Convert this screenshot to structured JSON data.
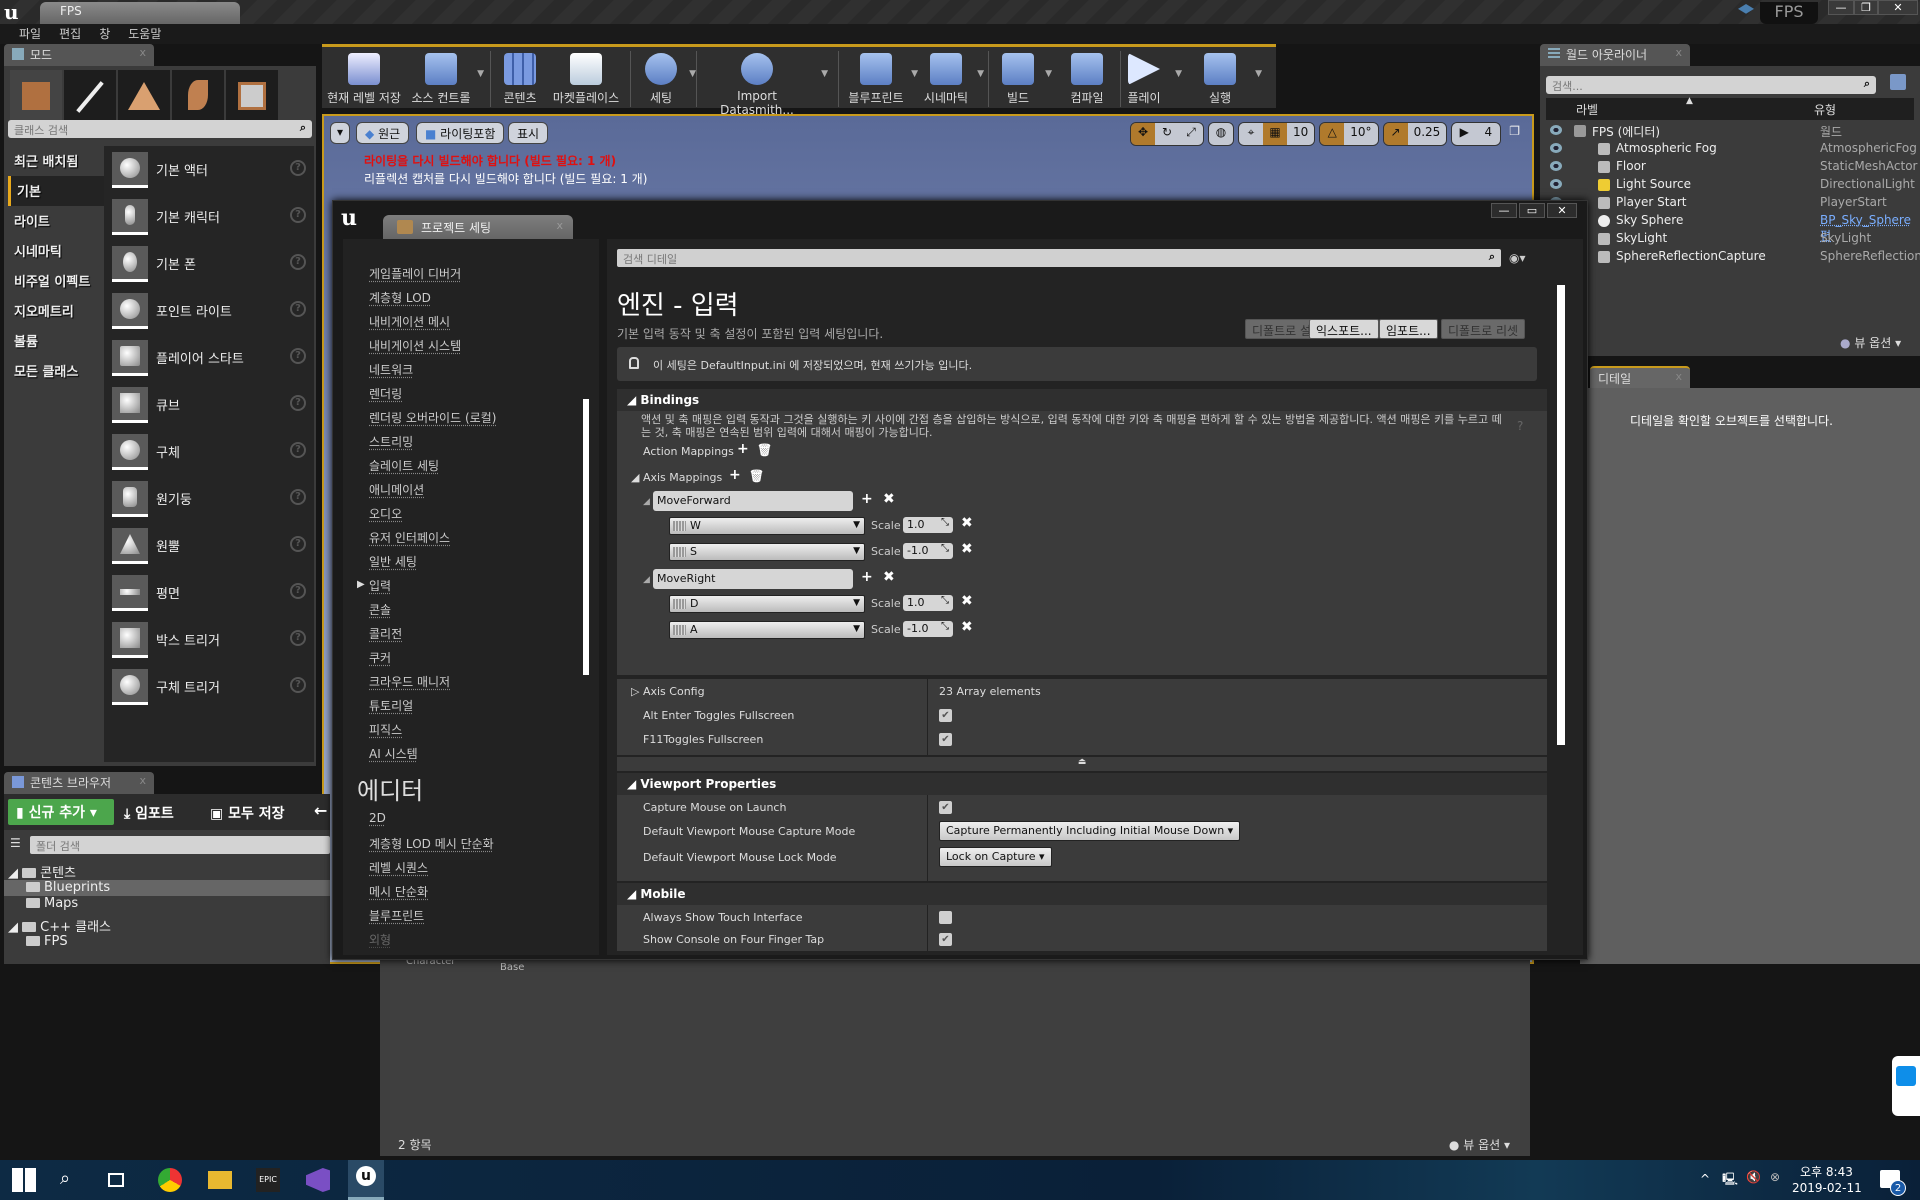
{
  "window": {
    "doc_tab": "FPS",
    "app_name": "FPS",
    "minimize": "—",
    "restore": "❐",
    "close": "✕"
  },
  "menu": [
    "파일",
    "편집",
    "창",
    "도움말"
  ],
  "modes": {
    "tab_label": "모드",
    "search_placeholder": "클래스 검색",
    "categories": [
      "최근 배치됨",
      "기본",
      "라이트",
      "시네마틱",
      "비주얼 이펙트",
      "지오메트리",
      "볼륨",
      "모든 클래스"
    ],
    "active_category": "기본",
    "items": [
      "기본 액터",
      "기본 캐릭터",
      "기본 폰",
      "포인트 라이트",
      "플레이어 스타트",
      "큐브",
      "구체",
      "원기둥",
      "원뿔",
      "평면",
      "박스 트리거",
      "구체 트리거"
    ]
  },
  "toolbar": {
    "buttons": [
      "현재 레벨 저장",
      "소스 컨트롤",
      "콘텐츠",
      "마켓플레이스",
      "세팅",
      "Import Datasmith...",
      "블루프린트",
      "시네마틱",
      "빌드",
      "컴파일",
      "플레이",
      "실행"
    ]
  },
  "viewport": {
    "perspective": "원근",
    "lit": "라이팅포함",
    "show": "표시",
    "lighting_warning": "라이팅을 다시 빌드해야 합니다 (빌드 필요: 1 개)",
    "reflection_warning": "리플렉션 캡처를 다시 빌드해야 합니다 (빌드 필요: 1 개)",
    "grid_snap": "10",
    "rotation_snap": "10°",
    "scale_snap": "0.25",
    "camera_speed": "4"
  },
  "outliner": {
    "tab_label": "월드 아웃라이너",
    "search_placeholder": "검색...",
    "col_label": "라벨",
    "col_type": "유형",
    "rows": [
      {
        "name": "FPS (에디터)",
        "type": "월드"
      },
      {
        "name": "Atmospheric Fog",
        "type": "AtmosphericFog"
      },
      {
        "name": "Floor",
        "type": "StaticMeshActor"
      },
      {
        "name": "Light Source",
        "type": "DirectionalLight"
      },
      {
        "name": "Player Start",
        "type": "PlayerStart"
      },
      {
        "name": "Sky Sphere",
        "type": "BP_Sky_Sphere 편"
      },
      {
        "name": "SkyLight",
        "type": "SkyLight"
      },
      {
        "name": "SphereReflectionCapture",
        "type": "SphereReflectionC"
      }
    ],
    "view_options": "뷰 옵션"
  },
  "details": {
    "tab_label": "디테일",
    "message": "디테일을 확인할 오브젝트를 선택합니다."
  },
  "content_browser": {
    "tab_label": "콘텐츠 브라우저",
    "add_new": "신규 추가",
    "import": "임포트",
    "save_all": "모두 저장",
    "folder_search_placeholder": "폴더 검색",
    "tree": [
      {
        "label": "콘텐츠",
        "level": 0
      },
      {
        "label": "Blueprints",
        "level": 1,
        "selected": true
      },
      {
        "label": "Maps",
        "level": 1
      },
      {
        "label": "C++ 클래스",
        "level": 0
      },
      {
        "label": "FPS",
        "level": 1
      }
    ],
    "assets": [
      "Character",
      "Base"
    ],
    "item_count": "2 항목",
    "view_options": "뷰 옵션"
  },
  "project_settings": {
    "tab_label": "프로젝트 세팅",
    "nav_engine": [
      "게임플레이 디버거",
      "계층형 LOD",
      "내비게이션 메시",
      "내비게이션 시스템",
      "네트워크",
      "렌더링",
      "렌더링 오버라이드 (로컬)",
      "스트리밍",
      "슬레이트 세팅",
      "애니메이션",
      "오디오",
      "유저 인터페이스",
      "일반 세팅",
      "입력",
      "콘솔",
      "콜리전",
      "쿠커",
      "크라우드 매니저",
      "튜토리얼",
      "피직스",
      "AI 시스템"
    ],
    "nav_editor_heading": "에디터",
    "nav_editor": [
      "2D",
      "계층형 LOD 메시 단순화",
      "레벨 시퀀스",
      "메시 단순화",
      "블루프린트",
      "외형"
    ],
    "search_placeholder": "검색 디테일",
    "title": "엔진 - 입력",
    "description": "기본 입력 동작 및 축 설정이 포함된 입력 세팅입니다.",
    "btn_set_default": "디폴트로 설정",
    "btn_export": "익스포트...",
    "btn_import": "임포트...",
    "btn_reset_default": "디폴트로 리셋",
    "config_note": "이 세팅은 DefaultInput.ini 에 저장되었으며, 현재 쓰기가능 입니다.",
    "bindings": {
      "heading": "Bindings",
      "help": "액션 및 축 매핑은 입력 동작과 그것을 실행하는 키 사이에 간접 층을 삽입하는 방식으로, 입력 동작에 대한 키와 축 매핑을 편하게 할 수 있는 방법을 제공합니다. 액션 매핑은 키를 누르고 떼는 것, 축 매핑은 연속된 범위 입력에 대해서 매핑이 가능합니다.",
      "action_mappings": "Action Mappings",
      "axis_mappings": "Axis Mappings",
      "axes": [
        {
          "name": "MoveForward",
          "keys": [
            {
              "key": "W",
              "scale": "1.0"
            },
            {
              "key": "S",
              "scale": "-1.0"
            }
          ]
        },
        {
          "name": "MoveRight",
          "keys": [
            {
              "key": "D",
              "scale": "1.0"
            },
            {
              "key": "A",
              "scale": "-1.0"
            }
          ]
        }
      ],
      "scale_label": "Scale",
      "axis_config": "Axis Config",
      "axis_config_value": "23 Array elements",
      "alt_enter": "Alt Enter Toggles Fullscreen",
      "alt_enter_checked": true,
      "f11": "F11Toggles Fullscreen",
      "f11_checked": true
    },
    "viewport_props": {
      "heading": "Viewport Properties",
      "capture_mouse": "Capture Mouse on Launch",
      "capture_mouse_checked": true,
      "capture_mode_label": "Default Viewport Mouse Capture Mode",
      "capture_mode_value": "Capture Permanently Including Initial Mouse Down",
      "lock_mode_label": "Default Viewport Mouse Lock Mode",
      "lock_mode_value": "Lock on Capture"
    },
    "mobile": {
      "heading": "Mobile",
      "touch": "Always Show Touch Interface",
      "touch_checked": false,
      "console": "Show Console on Four Finger Tap",
      "console_checked": true
    }
  },
  "taskbar": {
    "time": "오후 8:43",
    "date": "2019-02-11",
    "notifications": "2"
  }
}
